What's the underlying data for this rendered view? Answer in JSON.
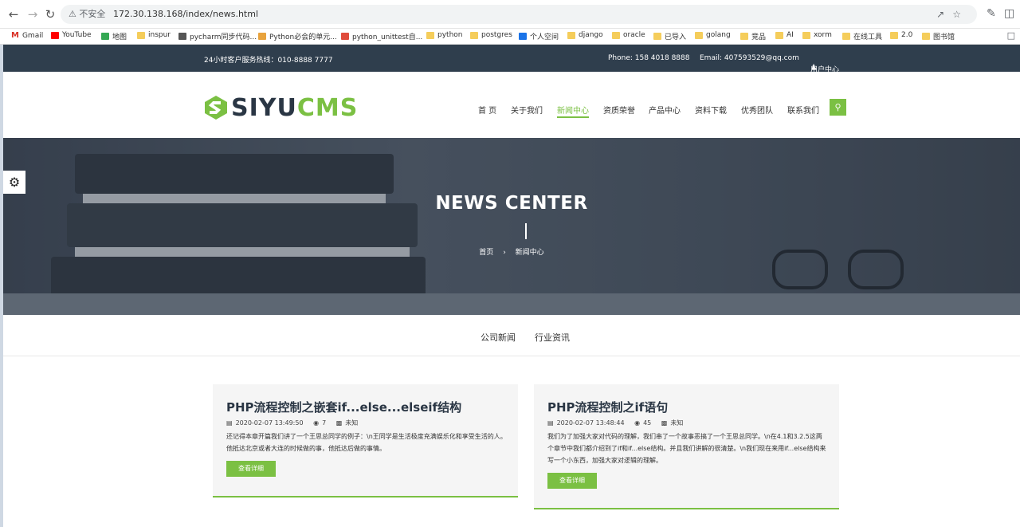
{
  "browser": {
    "security_label": "不安全",
    "url": "172.30.138.168/index/news.html"
  },
  "bookmarks": [
    "Gmail",
    "YouTube",
    "地图",
    "inspur",
    "pycharm同步代码...",
    "Python必会的单元...",
    "python_unittest自...",
    "python",
    "postgres",
    "个人空间",
    "django",
    "oracle",
    "已导入",
    "golang",
    "竞品",
    "AI",
    "xorm",
    "在线工具",
    "2.0",
    "图书馆"
  ],
  "topbar": {
    "hotline": "24小时客户服务热线：010-8888 7777",
    "phone": "Phone: 158 4018 8888",
    "email": "Email: 407593529@qq.com",
    "user_center": "用户中心"
  },
  "logo": {
    "part1": "SIYU",
    "part2": "CMS"
  },
  "menu": [
    "首 页",
    "关于我们",
    "新闻中心",
    "资质荣誉",
    "产品中心",
    "资料下载",
    "优秀团队",
    "联系我们"
  ],
  "active_menu": "新闻中心",
  "hero": {
    "title": "NEWS CENTER",
    "crumb_home": "首页",
    "crumb_current": "新闻中心"
  },
  "subnav": [
    "公司新闻",
    "行业资讯"
  ],
  "articles": [
    {
      "title": "PHP流程控制之嵌套if...else...elseif结构",
      "date": "2020-02-07 13:49:50",
      "views": "7",
      "author": "未知",
      "summary": "还记得本章开篇我们讲了一个王思总同学的例子：\\n王同学是生活极度充满娱乐化和享受生活的人。他抵达北京或者大连的时候做的事，他抵达后做的事情。",
      "button": "查看详细"
    },
    {
      "title": "PHP流程控制之if语句",
      "date": "2020-02-07 13:48:44",
      "views": "45",
      "author": "未知",
      "summary": "我们为了加强大家对代码的理解，我们串了一个故事恶搞了一个王思总同学。\\n在4.1和3.2.5这两个章节中我们都介绍到了if和if...else结构。并且我们讲解的很清楚。\\n我们现在来用if...else结构来写一个小东西，加强大家对逻辑的理解。",
      "button": "查看详细"
    }
  ],
  "colors": {
    "accent": "#7bc043",
    "dark": "#2f3e4d"
  }
}
